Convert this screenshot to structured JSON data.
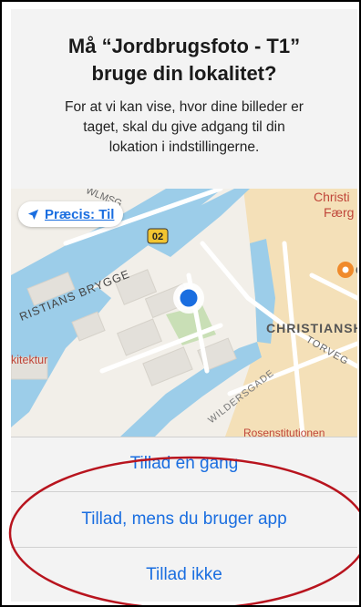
{
  "dialog": {
    "title": "Må “Jordbrugsfoto - T1”\nbruge din lokalitet?",
    "message": "For at vi kan vise, hvor dine billeder er\ntaget, skal du give adgang til din\nlokation i indstillingerne."
  },
  "map": {
    "precise_label": "Præcis: Til",
    "labels": {
      "christianshavn_top": "Christi",
      "faergerne": "Færg",
      "street_top": "WLMSG",
      "bridge_number": "02",
      "christians_brygge": "RISTIANS BRYGGE",
      "christianshavn": "CHRISTIANSH",
      "arkitektur": "kitektur",
      "wildersgade": "WILDERSGADE",
      "torvegade": "TORVEG",
      "partial_bottom": "Rosenstitutionen",
      "poi_letter": "C"
    }
  },
  "buttons": {
    "allow_once": "Tillad en gang",
    "allow_while_using": "Tillad, mens du bruger app",
    "dont_allow": "Tillad ikke"
  },
  "colors": {
    "accent": "#1a6ee0",
    "annotation": "#b8141e",
    "water": "#9ccde9",
    "land": "#f2efe9",
    "park": "#c9dfb6",
    "historic": "#f4e0b8"
  }
}
